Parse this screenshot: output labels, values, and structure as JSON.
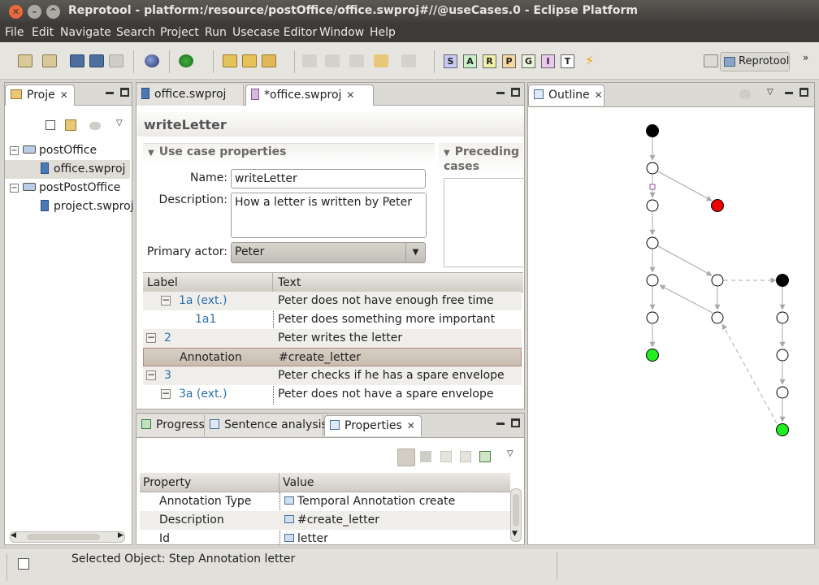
{
  "window": {
    "title": "Reprotool - platform:/resource/postOffice/office.swproj#//@useCases.0 - Eclipse Platform"
  },
  "menu": [
    "File",
    "Edit",
    "Navigate",
    "Search",
    "Project",
    "Run",
    "Usecase Editor",
    "Window",
    "Help"
  ],
  "toolbar": {
    "letters": [
      "S",
      "A",
      "R",
      "P",
      "G",
      "I",
      "T"
    ],
    "perspective_label": "Reprotool"
  },
  "project_explorer": {
    "tab_label": "Proje",
    "items": [
      {
        "label": "postOffice",
        "type": "project"
      },
      {
        "label": "office.swproj",
        "type": "file"
      },
      {
        "label": "postPostOffice",
        "type": "project"
      },
      {
        "label": "project.swproj",
        "type": "file"
      }
    ]
  },
  "editor": {
    "tabs": [
      "office.swproj",
      "*office.swproj"
    ],
    "heading": "writeLetter",
    "props_section": "Use case properties",
    "preceding_section": "Preceding cases",
    "name_label": "Name:",
    "name_value": "writeLetter",
    "desc_label": "Description:",
    "desc_value": "How a letter is written by Peter",
    "actor_label": "Primary actor:",
    "actor_value": "Peter",
    "table": {
      "col_label": "Label",
      "col_text": "Text",
      "rows": [
        {
          "label": "1a (ext.)",
          "text": "Peter does not have enough free time"
        },
        {
          "label": "1a1",
          "text": "Peter does something more important"
        },
        {
          "label": "2",
          "text": "Peter writes the letter"
        },
        {
          "label": "Annotation",
          "text": "#create_letter"
        },
        {
          "label": "3",
          "text": "Peter checks if he has a spare envelope"
        },
        {
          "label": "3a (ext.)",
          "text": "Peter does not have a spare envelope"
        }
      ]
    }
  },
  "bottom_panel": {
    "tabs": [
      "Progress",
      "Sentence analysis",
      "Properties"
    ],
    "col_property": "Property",
    "col_value": "Value",
    "rows": [
      {
        "property": "Annotation Type",
        "value": "Temporal Annotation create"
      },
      {
        "property": "Description",
        "value": "#create_letter"
      },
      {
        "property": "Id",
        "value": "letter"
      }
    ]
  },
  "outline": {
    "tab_label": "Outline"
  },
  "status": {
    "text": "Selected Object: Step Annotation letter"
  },
  "colors": {
    "node_start": "#000000",
    "node_fail": "#ee0000",
    "node_success": "#22ee22"
  }
}
